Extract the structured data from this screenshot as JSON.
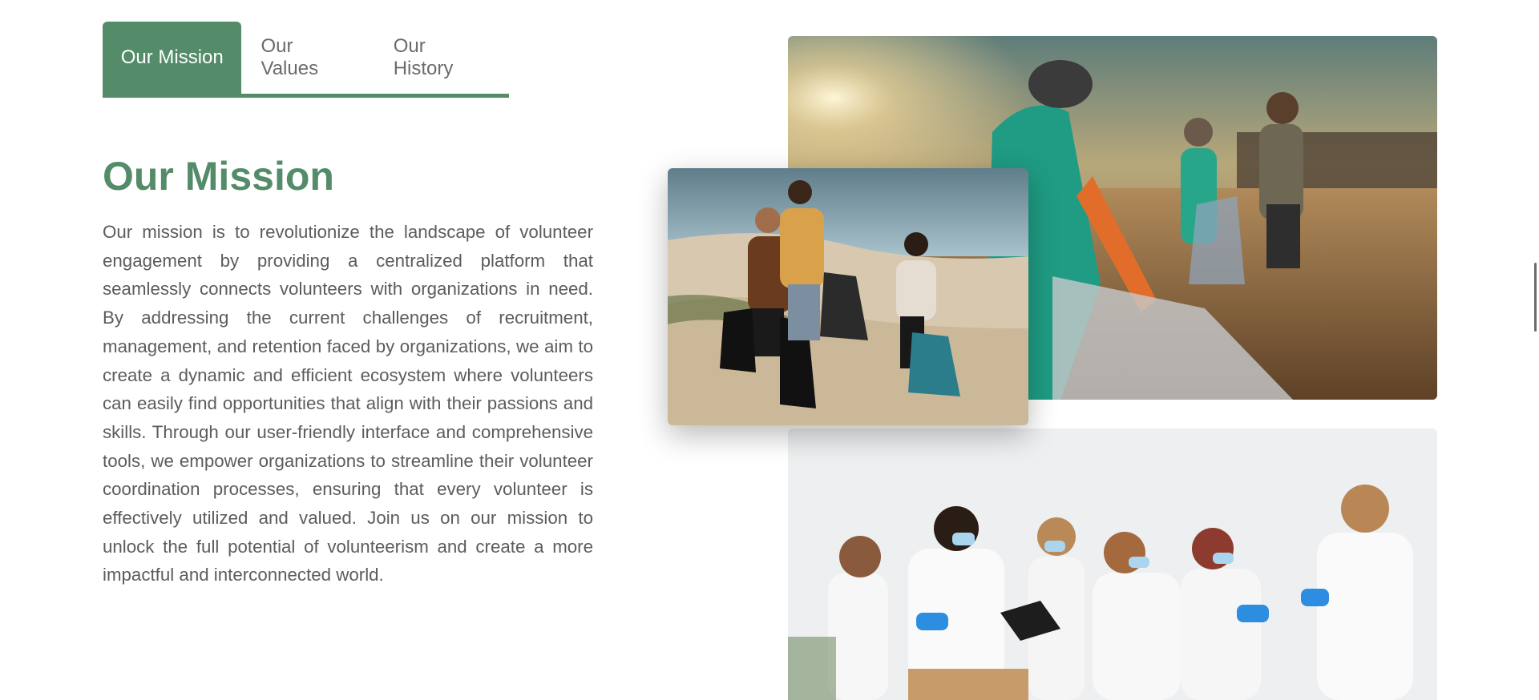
{
  "tabs": [
    {
      "label": "Our Mission",
      "active": true
    },
    {
      "label": "Our Values",
      "active": false
    },
    {
      "label": "Our History",
      "active": false
    }
  ],
  "section": {
    "title": "Our Mission",
    "body": "Our mission is to revolutionize the landscape of volunteer engagement by providing a centralized platform that seamlessly connects volunteers with organizations in need. By addressing the current challenges of recruitment, management, and retention faced by organizations, we aim to create a dynamic and efficient ecosystem where volunteers can easily find opportunities that align with their passions and skills. Through our user-friendly interface and comprehensive tools, we empower organizations to streamline their volunteer coordination processes, ensuring that every volunteer is effectively utilized and valued. Join us on our mission to unlock the full potential of volunteerism and create a more impactful and interconnected world."
  },
  "images": [
    {
      "name": "beach-cleanup-sunset-photo"
    },
    {
      "name": "beach-cleanup-trio-photo"
    },
    {
      "name": "volunteers-food-donation-photo"
    }
  ],
  "colors": {
    "accent": "#548c6a",
    "text": "#5c5c5c"
  }
}
